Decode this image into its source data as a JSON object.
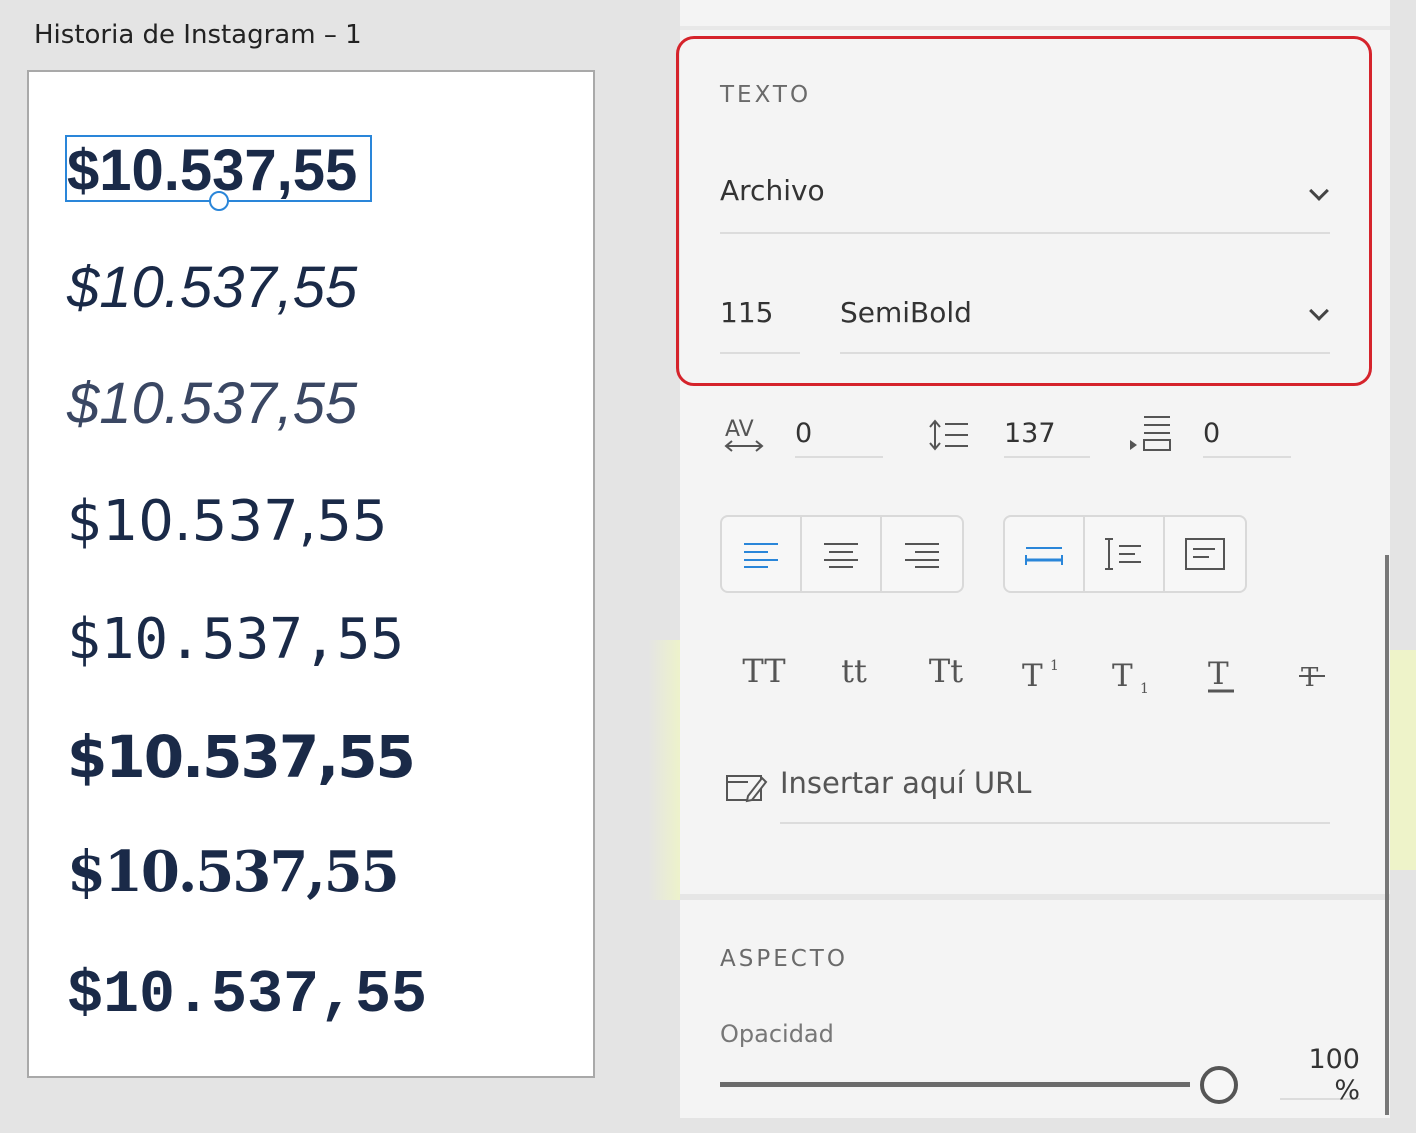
{
  "artboard": {
    "title": "Historia de Instagram – 1",
    "samples": [
      "$10.537,55",
      "$10.537,55",
      "$10.537,55",
      "$10.537,55",
      "$10.537,55",
      "$10.537,55",
      "$10.537,55",
      "$10.537,55"
    ]
  },
  "panel": {
    "text_section": {
      "label": "TEXTO",
      "font_family": "Archivo",
      "font_size": "115",
      "font_weight": "SemiBold",
      "char_spacing": "0",
      "line_spacing": "137",
      "paragraph_spacing": "0"
    },
    "link": {
      "placeholder": "Insertar aquí URL"
    },
    "appearance": {
      "label": "ASPECTO",
      "opacity_label": "Opacidad",
      "opacity_value": "100 %",
      "opacity_fraction": 1.0
    },
    "text_styles": [
      "TT",
      "tt",
      "Tt"
    ],
    "colors": {
      "highlight_box": "#d5232b",
      "selection": "#2a86d9",
      "active_icon": "#2a86d9"
    }
  }
}
